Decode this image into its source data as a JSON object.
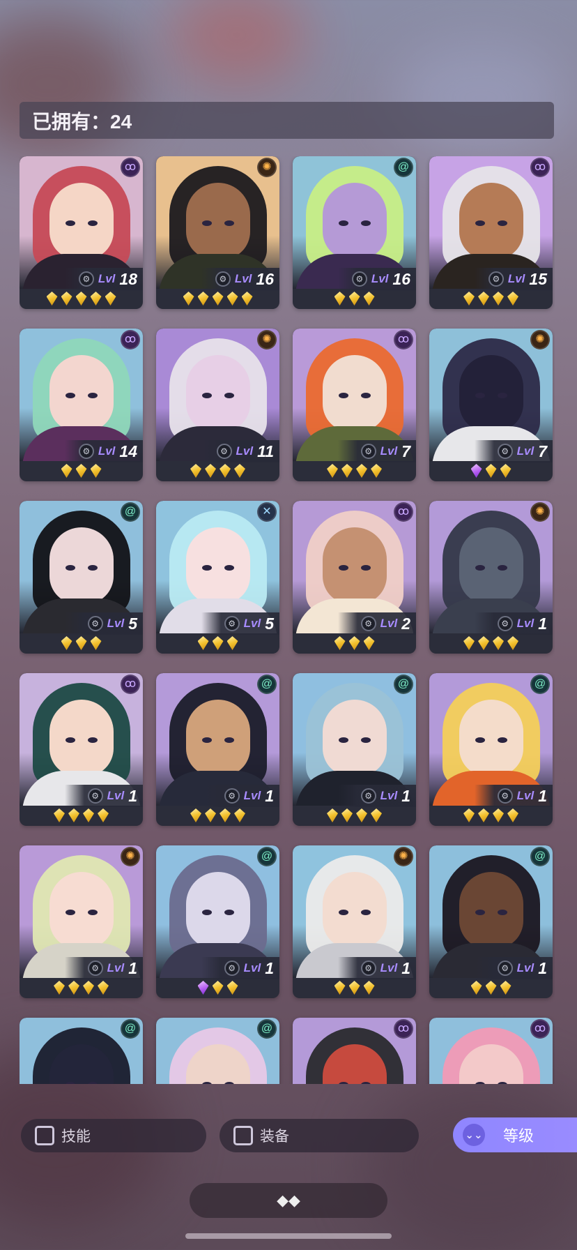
{
  "header": {
    "owned_label": "已拥有：24"
  },
  "colors": {
    "level_prefix": "#a88cff",
    "sort_button": "#9a8cff",
    "gem_gold": "#f3c12e",
    "gem_purple": "#b35cf0"
  },
  "heroes": [
    {
      "level_prefix": "Lvl",
      "level": "18",
      "faction_icon": "mystic-icon",
      "gems": [
        "gold",
        "gold",
        "gold",
        "gold",
        "gold"
      ],
      "bg": "#d7b6cf",
      "skin": "#f5d6c6",
      "hair": "#c64a56",
      "body": "#2a2230"
    },
    {
      "level_prefix": "Lvl",
      "level": "16",
      "faction_icon": "sun-icon",
      "gems": [
        "gold",
        "gold",
        "gold",
        "gold",
        "gold"
      ],
      "bg": "#e8c08e",
      "skin": "#9a6a4c",
      "hair": "#1c1a1f",
      "body": "#2f3327"
    },
    {
      "level_prefix": "Lvl",
      "level": "16",
      "faction_icon": "swirl-icon",
      "gems": [
        "gold",
        "gold",
        "gold"
      ],
      "bg": "#8fc3d8",
      "skin": "#b59ad6",
      "hair": "#c8ee86",
      "body": "#3a2a50"
    },
    {
      "level_prefix": "Lvl",
      "level": "15",
      "faction_icon": "mystic-icon",
      "gems": [
        "gold",
        "gold",
        "gold",
        "gold"
      ],
      "bg": "#c7a3e6",
      "skin": "#b57b56",
      "hair": "#e6e4e8",
      "body": "#2a2420"
    },
    {
      "level_prefix": "Lvl",
      "level": "14",
      "faction_icon": "mystic-icon",
      "gems": [
        "gold",
        "gold",
        "gold"
      ],
      "bg": "#8fc0dc",
      "skin": "#f3d6cf",
      "hair": "#8fd7b9",
      "body": "#5b2f5d"
    },
    {
      "level_prefix": "Lvl",
      "level": "11",
      "faction_icon": "sun-icon",
      "gems": [
        "gold",
        "gold",
        "gold",
        "gold"
      ],
      "bg": "#a98ad6",
      "skin": "#e7cfe6",
      "hair": "#e7e2ea",
      "body": "#2c2a3a"
    },
    {
      "level_prefix": "Lvl",
      "level": "7",
      "faction_icon": "mystic-icon",
      "gems": [
        "gold",
        "gold",
        "gold",
        "gold"
      ],
      "bg": "#b99ad8",
      "skin": "#f1dccf",
      "hair": "#ea6a30",
      "body": "#5e6a3a"
    },
    {
      "level_prefix": "Lvl",
      "level": "7",
      "faction_icon": "sun-icon",
      "gems": [
        "purple",
        "gold",
        "gold"
      ],
      "bg": "#8ec0d9",
      "skin": "#232139",
      "hair": "#2d2a48",
      "body": "#e7e7ea"
    },
    {
      "level_prefix": "Lvl",
      "level": "5",
      "faction_icon": "swirl-icon",
      "gems": [
        "gold",
        "gold",
        "gold"
      ],
      "bg": "#8fbfdc",
      "skin": "#ecd7d8",
      "hair": "#121216",
      "body": "#2a2a30"
    },
    {
      "level_prefix": "Lvl",
      "level": "5",
      "faction_icon": "cross-icon",
      "gems": [
        "gold",
        "gold",
        "gold"
      ],
      "bg": "#8fc3de",
      "skin": "#f7e0e0",
      "hair": "#b9eaf2",
      "body": "#e1dde8"
    },
    {
      "level_prefix": "Lvl",
      "level": "2",
      "faction_icon": "mystic-icon",
      "gems": [
        "gold",
        "gold",
        "gold"
      ],
      "bg": "#b69ad6",
      "skin": "#c59172",
      "hair": "#f0cfc7",
      "body": "#f3e6d4"
    },
    {
      "level_prefix": "Lvl",
      "level": "1",
      "faction_icon": "sun-icon",
      "gems": [
        "gold",
        "gold",
        "gold",
        "gold"
      ],
      "bg": "#b39ad8",
      "skin": "#5a6374",
      "hair": "#343849",
      "body": "#3a3f4e"
    },
    {
      "level_prefix": "Lvl",
      "level": "1",
      "faction_icon": "mystic-icon",
      "gems": [
        "gold",
        "gold",
        "gold",
        "gold"
      ],
      "bg": "#c7b2dd",
      "skin": "#f4d8c9",
      "hair": "#1e4a44",
      "body": "#e7e7ea"
    },
    {
      "level_prefix": "Lvl",
      "level": "1",
      "faction_icon": "swirl-icon",
      "gems": [
        "gold",
        "gold",
        "gold",
        "gold"
      ],
      "bg": "#b49ad9",
      "skin": "#cfa079",
      "hair": "#1b1c2a",
      "body": "#272a3a"
    },
    {
      "level_prefix": "Lvl",
      "level": "1",
      "faction_icon": "swirl-icon",
      "gems": [
        "gold",
        "gold",
        "gold",
        "gold"
      ],
      "bg": "#8fbfe0",
      "skin": "#f0dad3",
      "hair": "#9bc2d6",
      "body": "#1f222d"
    },
    {
      "level_prefix": "Lvl",
      "level": "1",
      "faction_icon": "swirl-icon",
      "gems": [
        "gold",
        "gold",
        "gold",
        "gold"
      ],
      "bg": "#b39ad9",
      "skin": "#f4dcca",
      "hair": "#f4cf5a",
      "body": "#e2642a"
    },
    {
      "level_prefix": "Lvl",
      "level": "1",
      "faction_icon": "sun-icon",
      "gems": [
        "gold",
        "gold",
        "gold",
        "gold"
      ],
      "bg": "#b99ad8",
      "skin": "#f7dcd2",
      "hair": "#dfe7b2",
      "body": "#d6d3c8"
    },
    {
      "level_prefix": "Lvl",
      "level": "1",
      "faction_icon": "swirl-icon",
      "gems": [
        "purple",
        "gold",
        "gold"
      ],
      "bg": "#8fbfe0",
      "skin": "#dcd8ea",
      "hair": "#6b6c8e",
      "body": "#3b3a52"
    },
    {
      "level_prefix": "Lvl",
      "level": "1",
      "faction_icon": "sun-icon",
      "gems": [
        "gold",
        "gold",
        "gold"
      ],
      "bg": "#8fc3de",
      "skin": "#f3dcd0",
      "hair": "#ecebea",
      "body": "#c9c9cf"
    },
    {
      "level_prefix": "Lvl",
      "level": "1",
      "faction_icon": "swirl-icon",
      "gems": [
        "gold",
        "gold",
        "gold"
      ],
      "bg": "#8dbfdc",
      "skin": "#6a4634",
      "hair": "#1b1620",
      "body": "#2a2a34"
    },
    {
      "level_prefix": "",
      "level": "",
      "faction_icon": "swirl-icon",
      "gems": [],
      "bg": "#8fbfdc",
      "skin": "#23253a",
      "hair": "#1a1c2c",
      "body": "#1a1c2c"
    },
    {
      "level_prefix": "",
      "level": "",
      "faction_icon": "swirl-icon",
      "gems": [],
      "bg": "#8fbfdc",
      "skin": "#eed4c9",
      "hair": "#e8c8e6",
      "body": "#2a2a30"
    },
    {
      "level_prefix": "",
      "level": "",
      "faction_icon": "mystic-icon",
      "gems": [],
      "bg": "#b49ad8",
      "skin": "#c64a3e",
      "hair": "#2a2a2e",
      "body": "#2a2a2e"
    },
    {
      "level_prefix": "",
      "level": "",
      "faction_icon": "mystic-icon",
      "gems": [],
      "bg": "#8fbfdc",
      "skin": "#f3c9c9",
      "hair": "#f29ab5",
      "body": "#2a2a30"
    }
  ],
  "filters": {
    "skill_label": "技能",
    "equip_label": "装备",
    "sort_label": "等级"
  },
  "icons": {
    "sort": "double-chevron-down-icon",
    "dock": "diamonds-icon"
  }
}
